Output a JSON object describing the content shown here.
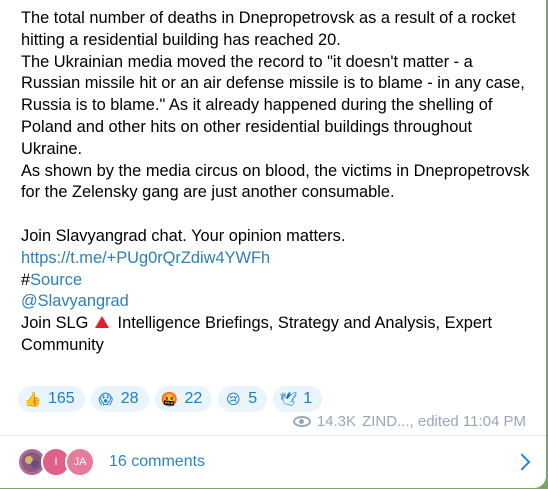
{
  "message": {
    "p1": "The total number of deaths in Dnepropetrovsk as a result of a rocket hitting a residential building has reached 20.",
    "p2": "The Ukrainian media moved the record to \"it doesn't matter - a Russian missile hit or an air defense missile is to blame - in any case, Russia is to blame.\" As it already happened during the shelling of Poland and other hits on other residential buildings throughout Ukraine.",
    "p3": "As shown by the media circus on blood, the victims in Dnepropetrovsk for the Zelensky gang are just another consumable.",
    "join_chat": "Join Slavyangrad chat. Your opinion matters.",
    "link": "https://t.me/+PUg0rQrZdiw4YWFh",
    "hashtag_symbol": "#",
    "hashtag_text": "Source",
    "mention": "@Slavyangrad",
    "join_slg_prefix": "Join SLG",
    "join_slg_suffix": "Intelligence Briefings, Strategy and Analysis, Expert Community"
  },
  "reactions": [
    {
      "emoji": "👍",
      "count": "165"
    },
    {
      "emoji": "😱",
      "count": "28"
    },
    {
      "emoji": "🤬",
      "count": "22"
    },
    {
      "emoji": "😢",
      "count": "5"
    },
    {
      "emoji": "🕊",
      "count": "1"
    }
  ],
  "meta": {
    "views": "14.3K",
    "signature": "ZIND..., edited 11:04 PM"
  },
  "comments": {
    "avatar2_letter": "I",
    "avatar3_letters": "JA",
    "label": "16 comments"
  },
  "colors": {
    "link": "#2b7fbd",
    "reaction_bg": "#eaf4fb",
    "background": "#7fa36b"
  }
}
